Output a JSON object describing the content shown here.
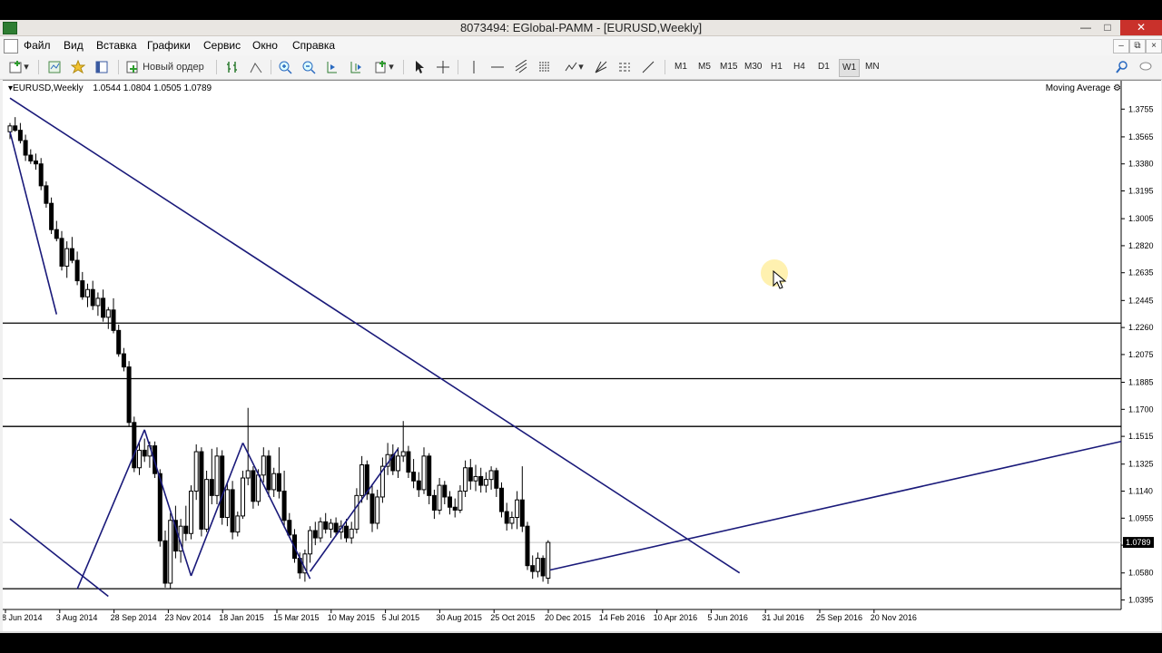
{
  "window": {
    "title": "8073494: EGlobal-PAMM - [EURUSD,Weekly]"
  },
  "menu": [
    "Файл",
    "Вид",
    "Вставка",
    "Графики",
    "Сервис",
    "Окно",
    "Справка"
  ],
  "toolbar": {
    "new_order": "Новый ордер",
    "timeframes": [
      "M1",
      "M5",
      "M15",
      "M30",
      "H1",
      "H4",
      "D1",
      "W1",
      "MN"
    ],
    "active_timeframe": "W1"
  },
  "chart": {
    "symbol": "EURUSD,Weekly",
    "ohlc": "1.0544 1.0804 1.0505 1.0789",
    "indicator_label": "Moving Average",
    "current_price_label": "1.0789"
  },
  "chart_data": {
    "type": "candlestick",
    "y_ticks": [
      "1.3755",
      "1.3565",
      "1.3380",
      "1.3195",
      "1.3005",
      "1.2820",
      "1.2635",
      "1.2445",
      "1.2260",
      "1.2075",
      "1.1885",
      "1.1700",
      "1.1515",
      "1.1325",
      "1.1140",
      "1.0955",
      "1.0770",
      "1.0580",
      "1.0395"
    ],
    "x_ticks": [
      "8 Jun 2014",
      "3 Aug 2014",
      "28 Sep 2014",
      "23 Nov 2014",
      "18 Jan 2015",
      "15 Mar 2015",
      "10 May 2015",
      "5 Jul 2015",
      "30 Aug 2015",
      "25 Oct 2015",
      "20 Dec 2015",
      "14 Feb 2016",
      "10 Apr 2016",
      "5 Jun 2016",
      "31 Jul 2016",
      "25 Sep 2016",
      "20 Nov 2016"
    ],
    "ylim": [
      1.033,
      1.385
    ],
    "horizontal_levels": [
      1.229,
      1.191,
      1.1583,
      1.0472
    ],
    "trend_lines": [
      [
        [
          0,
          1.383
        ],
        [
          141,
          1.058
        ]
      ],
      [
        [
          0,
          1.36
        ],
        [
          9,
          1.235
        ]
      ],
      [
        [
          0,
          1.095
        ],
        [
          19,
          1.042
        ]
      ],
      [
        [
          13,
          1.047
        ],
        [
          26,
          1.156
        ]
      ],
      [
        [
          26,
          1.156
        ],
        [
          35,
          1.056
        ]
      ],
      [
        [
          35,
          1.056
        ],
        [
          45,
          1.147
        ]
      ],
      [
        [
          45,
          1.147
        ],
        [
          58,
          1.054
        ]
      ],
      [
        [
          58,
          1.059
        ],
        [
          75,
          1.143
        ]
      ]
    ],
    "candles": [
      [
        1.36,
        1.366,
        1.355,
        1.364
      ],
      [
        1.364,
        1.37,
        1.36,
        1.361
      ],
      [
        1.361,
        1.366,
        1.352,
        1.354
      ],
      [
        1.354,
        1.358,
        1.34,
        1.344
      ],
      [
        1.344,
        1.348,
        1.338,
        1.34
      ],
      [
        1.34,
        1.345,
        1.334,
        1.338
      ],
      [
        1.338,
        1.342,
        1.32,
        1.323
      ],
      [
        1.323,
        1.326,
        1.308,
        1.311
      ],
      [
        1.311,
        1.315,
        1.29,
        1.293
      ],
      [
        1.293,
        1.299,
        1.285,
        1.287
      ],
      [
        1.287,
        1.292,
        1.265,
        1.268
      ],
      [
        1.268,
        1.285,
        1.26,
        1.28
      ],
      [
        1.28,
        1.288,
        1.27,
        1.272
      ],
      [
        1.272,
        1.278,
        1.255,
        1.258
      ],
      [
        1.258,
        1.264,
        1.245,
        1.247
      ],
      [
        1.247,
        1.256,
        1.24,
        1.252
      ],
      [
        1.252,
        1.258,
        1.238,
        1.241
      ],
      [
        1.241,
        1.25,
        1.234,
        1.246
      ],
      [
        1.246,
        1.252,
        1.23,
        1.233
      ],
      [
        1.233,
        1.24,
        1.225,
        1.238
      ],
      [
        1.238,
        1.246,
        1.222,
        1.224
      ],
      [
        1.224,
        1.228,
        1.206,
        1.208
      ],
      [
        1.208,
        1.212,
        1.196,
        1.199
      ],
      [
        1.199,
        1.203,
        1.158,
        1.161
      ],
      [
        1.161,
        1.165,
        1.127,
        1.13
      ],
      [
        1.13,
        1.147,
        1.125,
        1.142
      ],
      [
        1.142,
        1.15,
        1.134,
        1.138
      ],
      [
        1.138,
        1.148,
        1.13,
        1.145
      ],
      [
        1.145,
        1.148,
        1.123,
        1.126
      ],
      [
        1.126,
        1.129,
        1.076,
        1.08
      ],
      [
        1.08,
        1.087,
        1.048,
        1.051
      ],
      [
        1.051,
        1.099,
        1.047,
        1.094
      ],
      [
        1.094,
        1.104,
        1.068,
        1.073
      ],
      [
        1.073,
        1.095,
        1.065,
        1.09
      ],
      [
        1.09,
        1.104,
        1.08,
        1.085
      ],
      [
        1.085,
        1.118,
        1.081,
        1.114
      ],
      [
        1.114,
        1.146,
        1.108,
        1.141
      ],
      [
        1.141,
        1.144,
        1.083,
        1.088
      ],
      [
        1.088,
        1.128,
        1.086,
        1.122
      ],
      [
        1.122,
        1.143,
        1.105,
        1.111
      ],
      [
        1.111,
        1.144,
        1.105,
        1.138
      ],
      [
        1.138,
        1.142,
        1.091,
        1.096
      ],
      [
        1.096,
        1.12,
        1.09,
        1.115
      ],
      [
        1.115,
        1.121,
        1.081,
        1.086
      ],
      [
        1.086,
        1.1,
        1.083,
        1.097
      ],
      [
        1.097,
        1.128,
        1.095,
        1.123
      ],
      [
        1.123,
        1.171,
        1.118,
        1.128
      ],
      [
        1.128,
        1.131,
        1.102,
        1.107
      ],
      [
        1.107,
        1.129,
        1.104,
        1.125
      ],
      [
        1.125,
        1.144,
        1.12,
        1.138
      ],
      [
        1.138,
        1.142,
        1.11,
        1.115
      ],
      [
        1.115,
        1.13,
        1.11,
        1.126
      ],
      [
        1.126,
        1.144,
        1.109,
        1.114
      ],
      [
        1.114,
        1.128,
        1.089,
        1.094
      ],
      [
        1.094,
        1.099,
        1.082,
        1.084
      ],
      [
        1.084,
        1.088,
        1.065,
        1.068
      ],
      [
        1.068,
        1.072,
        1.054,
        1.058
      ],
      [
        1.058,
        1.074,
        1.052,
        1.071
      ],
      [
        1.071,
        1.09,
        1.065,
        1.087
      ],
      [
        1.087,
        1.093,
        1.077,
        1.082
      ],
      [
        1.082,
        1.096,
        1.079,
        1.093
      ],
      [
        1.093,
        1.099,
        1.085,
        1.088
      ],
      [
        1.088,
        1.095,
        1.082,
        1.092
      ],
      [
        1.092,
        1.096,
        1.083,
        1.086
      ],
      [
        1.086,
        1.094,
        1.081,
        1.09
      ],
      [
        1.09,
        1.095,
        1.079,
        1.082
      ],
      [
        1.082,
        1.093,
        1.078,
        1.088
      ],
      [
        1.088,
        1.116,
        1.085,
        1.111
      ],
      [
        1.111,
        1.138,
        1.106,
        1.132
      ],
      [
        1.132,
        1.135,
        1.108,
        1.112
      ],
      [
        1.112,
        1.119,
        1.086,
        1.092
      ],
      [
        1.092,
        1.115,
        1.088,
        1.11
      ],
      [
        1.11,
        1.137,
        1.106,
        1.131
      ],
      [
        1.131,
        1.147,
        1.125,
        1.139
      ],
      [
        1.139,
        1.146,
        1.125,
        1.128
      ],
      [
        1.128,
        1.144,
        1.123,
        1.138
      ],
      [
        1.138,
        1.162,
        1.134,
        1.141
      ],
      [
        1.141,
        1.145,
        1.123,
        1.127
      ],
      [
        1.127,
        1.136,
        1.116,
        1.121
      ],
      [
        1.121,
        1.127,
        1.11,
        1.115
      ],
      [
        1.115,
        1.144,
        1.112,
        1.138
      ],
      [
        1.138,
        1.14,
        1.105,
        1.111
      ],
      [
        1.111,
        1.115,
        1.095,
        1.101
      ],
      [
        1.101,
        1.123,
        1.098,
        1.118
      ],
      [
        1.118,
        1.121,
        1.105,
        1.11
      ],
      [
        1.11,
        1.114,
        1.098,
        1.103
      ],
      [
        1.103,
        1.109,
        1.096,
        1.101
      ],
      [
        1.101,
        1.118,
        1.099,
        1.114
      ],
      [
        1.114,
        1.135,
        1.11,
        1.13
      ],
      [
        1.13,
        1.136,
        1.115,
        1.121
      ],
      [
        1.121,
        1.132,
        1.114,
        1.124
      ],
      [
        1.124,
        1.13,
        1.113,
        1.118
      ],
      [
        1.118,
        1.127,
        1.113,
        1.122
      ],
      [
        1.122,
        1.131,
        1.115,
        1.128
      ],
      [
        1.128,
        1.13,
        1.11,
        1.116
      ],
      [
        1.116,
        1.12,
        1.096,
        1.1
      ],
      [
        1.1,
        1.106,
        1.087,
        1.092
      ],
      [
        1.092,
        1.1,
        1.088,
        1.096
      ],
      [
        1.096,
        1.114,
        1.088,
        1.108
      ],
      [
        1.108,
        1.131,
        1.086,
        1.09
      ],
      [
        1.09,
        1.093,
        1.06,
        1.063
      ],
      [
        1.063,
        1.07,
        1.054,
        1.059
      ],
      [
        1.059,
        1.072,
        1.055,
        1.068
      ],
      [
        1.068,
        1.07,
        1.052,
        1.056
      ],
      [
        1.0544,
        1.0804,
        1.0505,
        1.0789
      ]
    ]
  }
}
